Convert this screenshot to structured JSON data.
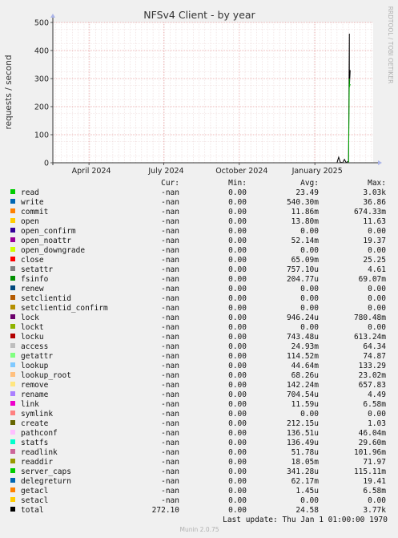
{
  "chart_data": {
    "type": "line",
    "title": "NFSv4 Client - by year",
    "ylabel": "requests / second",
    "watermark": "RRDTOOL / TOBI OETIKER",
    "ylim": [
      0,
      500
    ],
    "yticks": [
      0,
      100,
      200,
      300,
      400,
      500
    ],
    "x_tick_labels": [
      {
        "label": "April 2024",
        "date": "2024-04-01"
      },
      {
        "label": "July 2024",
        "date": "2024-07-01"
      },
      {
        "label": "October 2024",
        "date": "2024-10-01"
      },
      {
        "label": "January 2025",
        "date": "2025-01-01"
      }
    ],
    "xlim": [
      "2024-02-17",
      "2025-03-13"
    ],
    "grid": true,
    "colors": {
      "background": "#f0f0f0",
      "plot_bg": "#ffffff",
      "major_grid": "#e8a0a0",
      "minor_grid": "#ecd8d8",
      "axis": "#333333",
      "arrow": "#aab4e8",
      "total_line": "#000000",
      "read_line": "#00aa00"
    },
    "series": [
      {
        "name": "total",
        "color": "#000000",
        "points": [
          {
            "x": "2025-01-01",
            "y": 0
          },
          {
            "x": "2025-01-28",
            "y": 0.5
          },
          {
            "x": "2025-01-30",
            "y": 20
          },
          {
            "x": "2025-02-01",
            "y": 2
          },
          {
            "x": "2025-02-04",
            "y": 0.5
          },
          {
            "x": "2025-02-06",
            "y": 12
          },
          {
            "x": "2025-02-08",
            "y": 1
          },
          {
            "x": "2025-02-11",
            "y": 5
          },
          {
            "x": "2025-02-12",
            "y": 460
          },
          {
            "x": "2025-02-12",
            "y": 270
          },
          {
            "x": "2025-02-13",
            "y": 330
          }
        ]
      },
      {
        "name": "read",
        "color": "#00aa00",
        "points": [
          {
            "x": "2025-02-11",
            "y": 0
          },
          {
            "x": "2025-02-12",
            "y": 300
          },
          {
            "x": "2025-02-12",
            "y": 270
          },
          {
            "x": "2025-02-13",
            "y": 280
          }
        ]
      }
    ],
    "legend": {
      "headers": {
        "cur": "Cur:",
        "min": "Min:",
        "avg": "Avg:",
        "max": "Max:"
      },
      "rows": [
        {
          "name": "read",
          "color": "#00cc00",
          "cur": "-nan",
          "min": "0.00",
          "avg": "23.49",
          "max": "3.03k"
        },
        {
          "name": "write",
          "color": "#0066b3",
          "cur": "-nan",
          "min": "0.00",
          "avg": "540.30m",
          "max": "36.86"
        },
        {
          "name": "commit",
          "color": "#ff8000",
          "cur": "-nan",
          "min": "0.00",
          "avg": "11.86m",
          "max": "674.33m"
        },
        {
          "name": "open",
          "color": "#ffcc00",
          "cur": "-nan",
          "min": "0.00",
          "avg": "13.80m",
          "max": "11.63"
        },
        {
          "name": "open_confirm",
          "color": "#330099",
          "cur": "-nan",
          "min": "0.00",
          "avg": "0.00",
          "max": "0.00"
        },
        {
          "name": "open_noattr",
          "color": "#990099",
          "cur": "-nan",
          "min": "0.00",
          "avg": "52.14m",
          "max": "19.37"
        },
        {
          "name": "open_downgrade",
          "color": "#ccff00",
          "cur": "-nan",
          "min": "0.00",
          "avg": "0.00",
          "max": "0.00"
        },
        {
          "name": "close",
          "color": "#ff0000",
          "cur": "-nan",
          "min": "0.00",
          "avg": "65.09m",
          "max": "25.25"
        },
        {
          "name": "setattr",
          "color": "#808080",
          "cur": "-nan",
          "min": "0.00",
          "avg": "757.10u",
          "max": "4.61"
        },
        {
          "name": "fsinfo",
          "color": "#008f00",
          "cur": "-nan",
          "min": "0.00",
          "avg": "204.77u",
          "max": "69.07m"
        },
        {
          "name": "renew",
          "color": "#00487d",
          "cur": "-nan",
          "min": "0.00",
          "avg": "0.00",
          "max": "0.00"
        },
        {
          "name": "setclientid",
          "color": "#b35a00",
          "cur": "-nan",
          "min": "0.00",
          "avg": "0.00",
          "max": "0.00"
        },
        {
          "name": "setclientid_confirm",
          "color": "#b38f00",
          "cur": "-nan",
          "min": "0.00",
          "avg": "0.00",
          "max": "0.00"
        },
        {
          "name": "lock",
          "color": "#6b006b",
          "cur": "-nan",
          "min": "0.00",
          "avg": "946.24u",
          "max": "780.48m"
        },
        {
          "name": "lockt",
          "color": "#8fb300",
          "cur": "-nan",
          "min": "0.00",
          "avg": "0.00",
          "max": "0.00"
        },
        {
          "name": "locku",
          "color": "#b30000",
          "cur": "-nan",
          "min": "0.00",
          "avg": "743.48u",
          "max": "613.24m"
        },
        {
          "name": "access",
          "color": "#bebebe",
          "cur": "-nan",
          "min": "0.00",
          "avg": "24.93m",
          "max": "64.34"
        },
        {
          "name": "getattr",
          "color": "#80ff80",
          "cur": "-nan",
          "min": "0.00",
          "avg": "114.52m",
          "max": "74.87"
        },
        {
          "name": "lookup",
          "color": "#80c9ff",
          "cur": "-nan",
          "min": "0.00",
          "avg": "44.64m",
          "max": "133.29"
        },
        {
          "name": "lookup_root",
          "color": "#ffc080",
          "cur": "-nan",
          "min": "0.00",
          "avg": "68.26u",
          "max": "23.02m"
        },
        {
          "name": "remove",
          "color": "#ffe680",
          "cur": "-nan",
          "min": "0.00",
          "avg": "142.24m",
          "max": "657.83"
        },
        {
          "name": "rename",
          "color": "#aa80ff",
          "cur": "-nan",
          "min": "0.00",
          "avg": "704.54u",
          "max": "4.49"
        },
        {
          "name": "link",
          "color": "#ee00cc",
          "cur": "-nan",
          "min": "0.00",
          "avg": "11.59u",
          "max": "6.58m"
        },
        {
          "name": "symlink",
          "color": "#ff8080",
          "cur": "-nan",
          "min": "0.00",
          "avg": "0.00",
          "max": "0.00"
        },
        {
          "name": "create",
          "color": "#666600",
          "cur": "-nan",
          "min": "0.00",
          "avg": "212.15u",
          "max": "1.03"
        },
        {
          "name": "pathconf",
          "color": "#ffbfff",
          "cur": "-nan",
          "min": "0.00",
          "avg": "136.51u",
          "max": "46.04m"
        },
        {
          "name": "statfs",
          "color": "#00ffcc",
          "cur": "-nan",
          "min": "0.00",
          "avg": "136.49u",
          "max": "29.60m"
        },
        {
          "name": "readlink",
          "color": "#cc6699",
          "cur": "-nan",
          "min": "0.00",
          "avg": "51.78u",
          "max": "101.96m"
        },
        {
          "name": "readdir",
          "color": "#999900",
          "cur": "-nan",
          "min": "0.00",
          "avg": "18.05m",
          "max": "71.97"
        },
        {
          "name": "server_caps",
          "color": "#00cc00",
          "cur": "-nan",
          "min": "0.00",
          "avg": "341.28u",
          "max": "115.11m"
        },
        {
          "name": "delegreturn",
          "color": "#0066b3",
          "cur": "-nan",
          "min": "0.00",
          "avg": "62.17m",
          "max": "19.41"
        },
        {
          "name": "getacl",
          "color": "#ff8000",
          "cur": "-nan",
          "min": "0.00",
          "avg": "1.45u",
          "max": "6.58m"
        },
        {
          "name": "setacl",
          "color": "#ffcc00",
          "cur": "-nan",
          "min": "0.00",
          "avg": "0.00",
          "max": "0.00"
        },
        {
          "name": "total",
          "color": "#000000",
          "cur": "272.10",
          "min": "0.00",
          "avg": "24.58",
          "max": "3.77k"
        }
      ]
    },
    "last_update": "Last update: Thu Jan  1 01:00:00 1970",
    "footer": "Munin 2.0.75"
  }
}
